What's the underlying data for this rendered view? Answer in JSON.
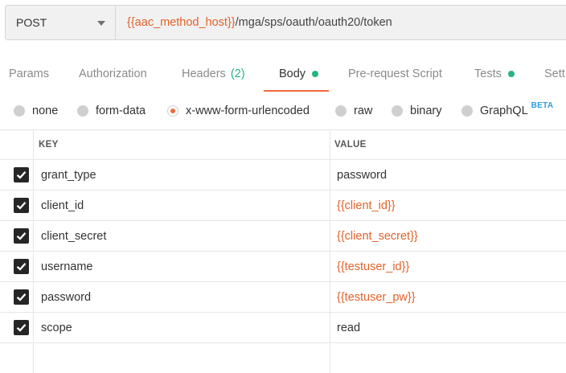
{
  "request": {
    "method": "POST",
    "url_variable": "{{aac_method_host}}",
    "url_path": "/mga/sps/oauth/oauth20/token"
  },
  "tabs": [
    {
      "label": "Params"
    },
    {
      "label": "Authorization"
    },
    {
      "label": "Headers",
      "count": "(2)"
    },
    {
      "label": "Body"
    },
    {
      "label": "Pre-request Script"
    },
    {
      "label": "Tests"
    },
    {
      "label": "Sett"
    }
  ],
  "body_types": [
    {
      "label": "none"
    },
    {
      "label": "form-data"
    },
    {
      "label": "x-www-form-urlencoded",
      "selected": true
    },
    {
      "label": "raw"
    },
    {
      "label": "binary"
    },
    {
      "label": "GraphQL",
      "badge": "BETA"
    }
  ],
  "table": {
    "key_header": "KEY",
    "value_header": "VALUE",
    "rows": [
      {
        "key": "grant_type",
        "value": "password",
        "checked": true
      },
      {
        "key": "client_id",
        "value": "{{client_id}}",
        "checked": true
      },
      {
        "key": "client_secret",
        "value": "{{client_secret}}",
        "checked": true
      },
      {
        "key": "username",
        "value": "{{testuser_id}}",
        "checked": true
      },
      {
        "key": "password",
        "value": "{{testuser_pw}}",
        "checked": true
      },
      {
        "key": "scope",
        "value": "read",
        "checked": true
      }
    ]
  },
  "colors": {
    "accent": "#f26b3a",
    "variable": "#e2622a",
    "indicator": "#26b47f",
    "beta": "#2a9be0"
  }
}
